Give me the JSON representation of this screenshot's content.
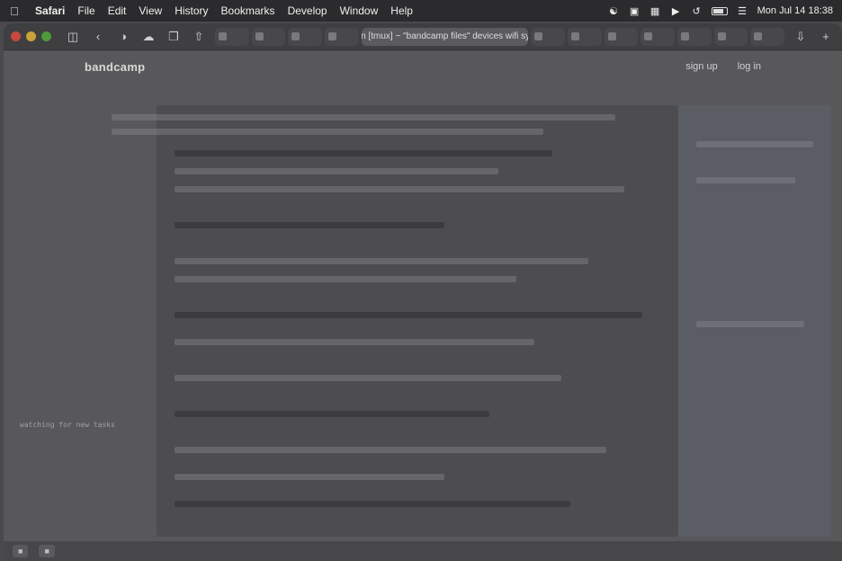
{
  "menubar": {
    "app_name": "Safari",
    "items": [
      "File",
      "Edit",
      "View",
      "History",
      "Bookmarks",
      "Develop",
      "Window",
      "Help"
    ],
    "clock": "Mon Jul 14  18:38"
  },
  "browser": {
    "active_tab_title": "[bash] main [tmux] ~ \"bandcamp files\" devices wifi sy... — tmux"
  },
  "page": {
    "logo": "bandcamp",
    "sign_up": "sign up",
    "log_in": "log in"
  },
  "terminal": {
    "watching": "watching for new tasks",
    "prefix": "> "
  }
}
